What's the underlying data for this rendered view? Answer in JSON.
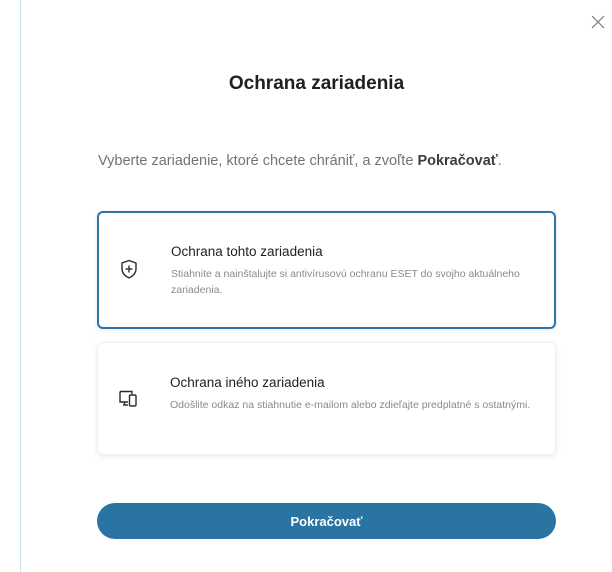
{
  "dialog": {
    "title": "Ochrana zariadenia",
    "intro_text": "Vyberte zariadenie, ktoré chcete chrániť, a zvoľte ",
    "intro_bold": "Pokračovať",
    "intro_end": "."
  },
  "options": [
    {
      "title": "Ochrana tohto zariadenia",
      "description": "Stiahnite a nainštalujte si antivírusovú ochranu ESET do svojho aktuálneho zariadenia.",
      "icon": "shield-plus-icon",
      "selected": true
    },
    {
      "title": "Ochrana iného zariadenia",
      "description": "Odošlite odkaz na stiahnutie e-mailom alebo zdieľajte predplatné s ostatnými.",
      "icon": "devices-icon",
      "selected": false
    }
  ],
  "buttons": {
    "continue_label": "Pokračovať",
    "close_icon": "close-icon"
  },
  "colors": {
    "accent": "#2a74a4",
    "selected_border": "#2a76a8",
    "window_border": "#c7e3ef"
  }
}
